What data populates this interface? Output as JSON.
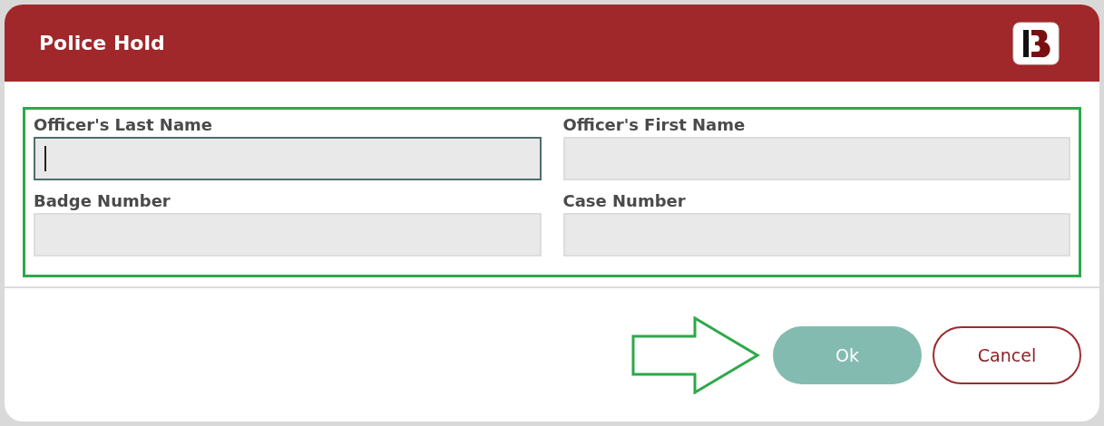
{
  "dialog": {
    "title": "Police Hold"
  },
  "fields": [
    {
      "label": "Officer's Last Name",
      "focused": true
    },
    {
      "label": "Officer's First Name",
      "focused": false
    },
    {
      "label": "Badge Number",
      "focused": false
    },
    {
      "label": "Case Number",
      "focused": false
    }
  ],
  "buttons": [
    {
      "label": "Ok",
      "kind": "primary"
    },
    {
      "label": "Cancel",
      "kind": "secondary"
    }
  ]
}
